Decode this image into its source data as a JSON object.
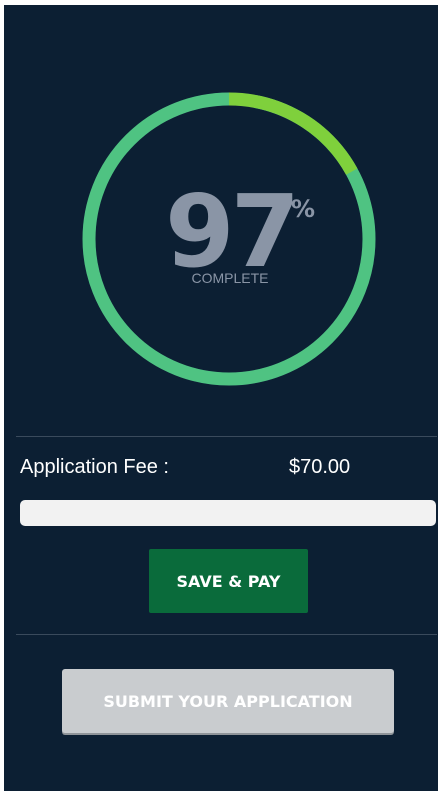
{
  "progress": {
    "percent": 97,
    "percent_text": "97",
    "percent_sign": "%",
    "complete_label": "COMPLETE",
    "colors": {
      "ring_main": "#4fc382",
      "ring_highlight": "#7fd03c",
      "ring_remaining": "#17324b"
    }
  },
  "fee": {
    "label": "Application Fee :",
    "amount": "$70.00"
  },
  "buttons": {
    "save_pay": "SAVE & PAY",
    "submit": "SUBMIT YOUR APPLICATION"
  },
  "colors": {
    "panel_background": "#0c1f33",
    "save_pay_button": "#0a6b3b",
    "submit_button_disabled": "#c9cccf"
  }
}
